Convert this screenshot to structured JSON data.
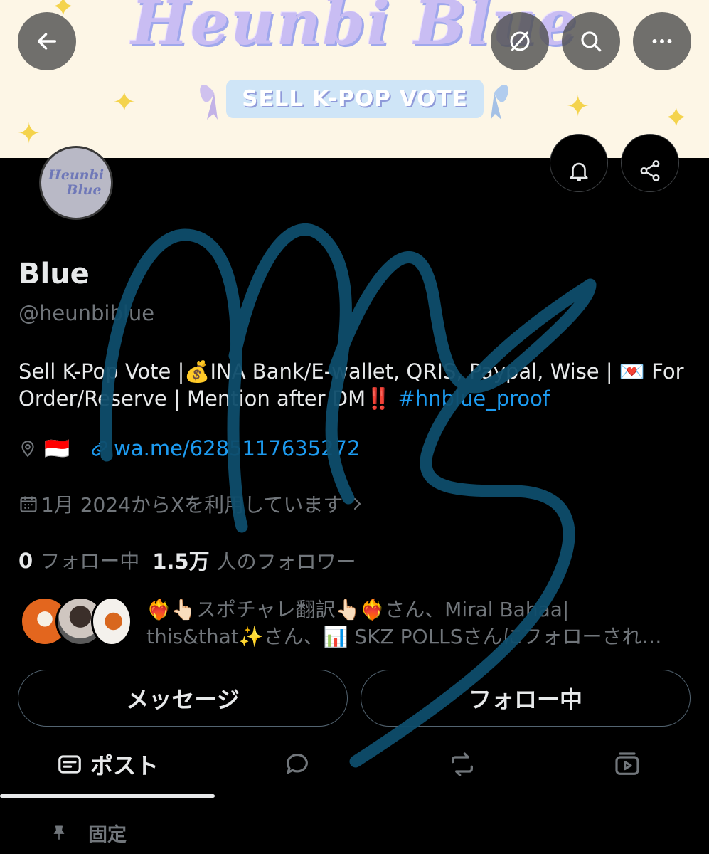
{
  "banner": {
    "title": "Heunbi Blue",
    "ribbon_text": "SELL K-POP VOTE"
  },
  "header_buttons": {
    "back": "back-arrow-icon",
    "hide": "eye-slash-icon",
    "search": "search-icon",
    "more": "more-icon"
  },
  "profile_actions": {
    "notifications": "bell-icon",
    "share": "share-icon"
  },
  "avatar": {
    "line1": "Heunbi",
    "line2": "Blue"
  },
  "profile": {
    "name": "Blue",
    "handle": "@heunbiblue",
    "bio_text": "Sell K-Pop Vote |💰INA Bank/E-wallet, QRIS, Paypal, Wise | 💌 For Order/Reserve | Mention after DM‼️ ",
    "bio_hashtag": "#hnblue_proof",
    "location_flag": "🇮🇩",
    "website": "wa.me/6285117635272",
    "joined": "1月 2024からXを利用しています"
  },
  "stats": {
    "following_count": "0",
    "following_label": "フォロー中",
    "followers_count": "1.5万",
    "followers_label": "人のフォロワー"
  },
  "followed_by": {
    "line1": "❤️‍🔥👆🏻スポチャレ翻訳👆🏻❤️‍🔥さん、Miral Bahaa|",
    "line2": "this&that✨さん、📊 SKZ POLLSさんにフォローされ…"
  },
  "buttons": {
    "message": "メッセージ",
    "following": "フォロー中"
  },
  "tabs": {
    "posts": "ポスト",
    "replies": "reply-icon",
    "reposts": "repost-icon",
    "media": "media-icon"
  },
  "pinned": {
    "label": "固定"
  },
  "colors": {
    "background": "#000000",
    "link": "#1d9bf0",
    "muted": "#71767b",
    "scribble": "#0e4d6b",
    "banner_bg": "#fdf6e6"
  }
}
